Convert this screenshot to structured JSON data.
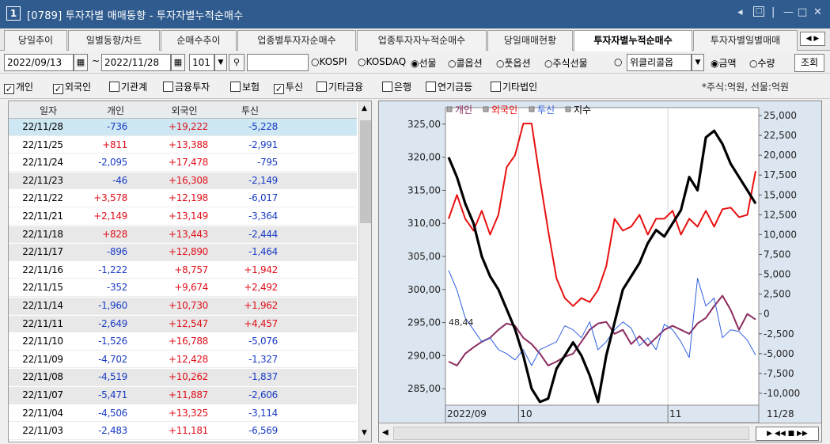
{
  "window": {
    "number": "1",
    "title": "[0789] 투자자별 매매동향 - 투자자별누적순매수"
  },
  "tabs": [
    {
      "label": "당일추이",
      "w": 0
    },
    {
      "label": "일별동향/차트"
    },
    {
      "label": "순매수추이"
    },
    {
      "label": "업종별투자자순매수"
    },
    {
      "label": "업종투자자누적순매수"
    },
    {
      "label": "당일매매현황"
    },
    {
      "label": "투자자별누적순매수"
    },
    {
      "label": "투자자별일별매매"
    }
  ],
  "toolbar": {
    "start_date": "2022/09/13",
    "end_date": "2022/11/28",
    "code": "101",
    "market_options": [
      "KOSPI",
      "KOSDAQ",
      "선물",
      "콜옵션",
      "풋옵션",
      "주식선물"
    ],
    "market_selected": "선물",
    "weekly_label": "위클리콜옵",
    "unit_options": [
      "금액",
      "수량"
    ],
    "unit_selected": "금액",
    "query_button": "조회"
  },
  "investors": [
    {
      "label": "개인",
      "checked": true
    },
    {
      "label": "외국인",
      "checked": true
    },
    {
      "label": "기관계",
      "checked": false
    },
    {
      "label": "금융투자",
      "checked": false
    },
    {
      "label": "보험",
      "checked": false
    },
    {
      "label": "투신",
      "checked": true
    },
    {
      "label": "기타금융",
      "checked": false
    },
    {
      "label": "은행",
      "checked": false
    },
    {
      "label": "연기금등",
      "checked": false
    },
    {
      "label": "기타법인",
      "checked": false
    }
  ],
  "unit_note": "*주식:억원, 선물:억원",
  "table": {
    "headers": [
      "일자",
      "개인",
      "외국인",
      "투신"
    ],
    "rows": [
      [
        "22/11/28",
        "-736",
        "+19,222",
        "-5,228"
      ],
      [
        "22/11/25",
        "+811",
        "+13,388",
        "-2,991"
      ],
      [
        "22/11/24",
        "-2,095",
        "+17,478",
        "-795"
      ],
      [
        "22/11/23",
        "-46",
        "+16,308",
        "-2,149"
      ],
      [
        "22/11/22",
        "+3,578",
        "+12,198",
        "-6,017"
      ],
      [
        "22/11/21",
        "+2,149",
        "+13,149",
        "-3,364"
      ],
      [
        "22/11/18",
        "+828",
        "+13,443",
        "-2,444"
      ],
      [
        "22/11/17",
        "-896",
        "+12,890",
        "-1,464"
      ],
      [
        "22/11/16",
        "-1,222",
        "+8,757",
        "+1,942"
      ],
      [
        "22/11/15",
        "-352",
        "+9,674",
        "+2,492"
      ],
      [
        "22/11/14",
        "-1,960",
        "+10,730",
        "+1,962"
      ],
      [
        "22/11/11",
        "-2,649",
        "+12,547",
        "+4,457"
      ],
      [
        "22/11/10",
        "-1,526",
        "+16,788",
        "-5,076"
      ],
      [
        "22/11/09",
        "-4,702",
        "+12,428",
        "-1,327"
      ],
      [
        "22/11/08",
        "-4,519",
        "+10,262",
        "-1,837"
      ],
      [
        "22/11/07",
        "-5,471",
        "+11,887",
        "-2,606"
      ],
      [
        "22/11/04",
        "-4,506",
        "+13,325",
        "-3,114"
      ],
      [
        "22/11/03",
        "-2,483",
        "+11,181",
        "-6,569"
      ]
    ]
  },
  "chart": {
    "legend": [
      {
        "name": "개인",
        "color": "#8b2b5e"
      },
      {
        "name": "외국인",
        "color": "#e81010"
      },
      {
        "name": "투신",
        "color": "#2f5fe0"
      },
      {
        "name": "지수",
        "color": "#000000"
      }
    ],
    "left_ticks": [
      "325,00",
      "320,00",
      "315,00",
      "310,00",
      "305,00",
      "300,00",
      "295,00",
      "290,00",
      "285,00"
    ],
    "right_ticks": [
      "25,000",
      "22,500",
      "20,000",
      "17,500",
      "15,000",
      "12,500",
      "10,000",
      "7,500",
      "5,000",
      "2,500",
      "0",
      "-2,500",
      "-5,000",
      "-7,500",
      "-10,000"
    ],
    "x_labels": [
      "2022/09",
      "10",
      "11"
    ],
    "x_end": "11/28",
    "marker_label": "48,44"
  },
  "chart_data": {
    "type": "line",
    "title": "",
    "ylim_left": [
      282.5,
      327.5
    ],
    "ylim_right": [
      -11500,
      26000
    ],
    "series": [
      {
        "name": "지수",
        "axis": "left",
        "color": "#000000",
        "values": [
          320,
          317,
          313,
          310,
          305,
          302,
          300,
          297,
          294,
          290,
          285,
          283,
          283.5,
          288,
          290,
          292,
          290,
          287,
          283,
          290,
          295,
          300,
          302,
          304,
          307,
          309,
          308,
          310,
          312,
          317,
          315,
          323,
          324,
          322,
          319,
          317,
          315,
          313
        ]
      },
      {
        "name": "외국인",
        "axis": "right",
        "color": "#e81010",
        "values": [
          12000,
          15000,
          12000,
          10500,
          13000,
          10000,
          12500,
          18500,
          20000,
          24000,
          24000,
          17000,
          10500,
          4500,
          2000,
          1000,
          2000,
          1500,
          3000,
          6000,
          12000,
          10500,
          11000,
          12500,
          10000,
          12000,
          12000,
          13000,
          10000,
          12000,
          11000,
          13000,
          11000,
          13200,
          13400,
          12200,
          12500,
          18000
        ]
      },
      {
        "name": "개인",
        "axis": "right",
        "color": "#8b2b5e",
        "values": [
          -6000,
          -6500,
          -5000,
          -4200,
          -3500,
          -3000,
          -2000,
          -1200,
          -1500,
          -3000,
          -3800,
          -5000,
          -6500,
          -6000,
          -5400,
          -5000,
          -3500,
          -2000,
          -1200,
          -1000,
          -2500,
          -2000,
          -3800,
          -2800,
          -4000,
          -3000,
          -2000,
          -1500,
          -2000,
          -2500,
          -1200,
          -500,
          1000,
          2300,
          500,
          -2000,
          0,
          -700
        ]
      },
      {
        "name": "투신",
        "axis": "right",
        "color": "#2f5fe0",
        "values": [
          5500,
          3000,
          -500,
          -2000,
          -3500,
          -3000,
          -4500,
          -5000,
          -5800,
          -4500,
          -6500,
          -4500,
          -4000,
          -3500,
          -1500,
          -2000,
          -3000,
          -1000,
          -4500,
          -3500,
          -2000,
          -1000,
          -1800,
          -4000,
          -3000,
          -4500,
          -1300,
          -2000,
          -3500,
          -5500,
          4500,
          1000,
          2000,
          -3000,
          -2000,
          -2200,
          -3300,
          -5200
        ]
      }
    ]
  }
}
